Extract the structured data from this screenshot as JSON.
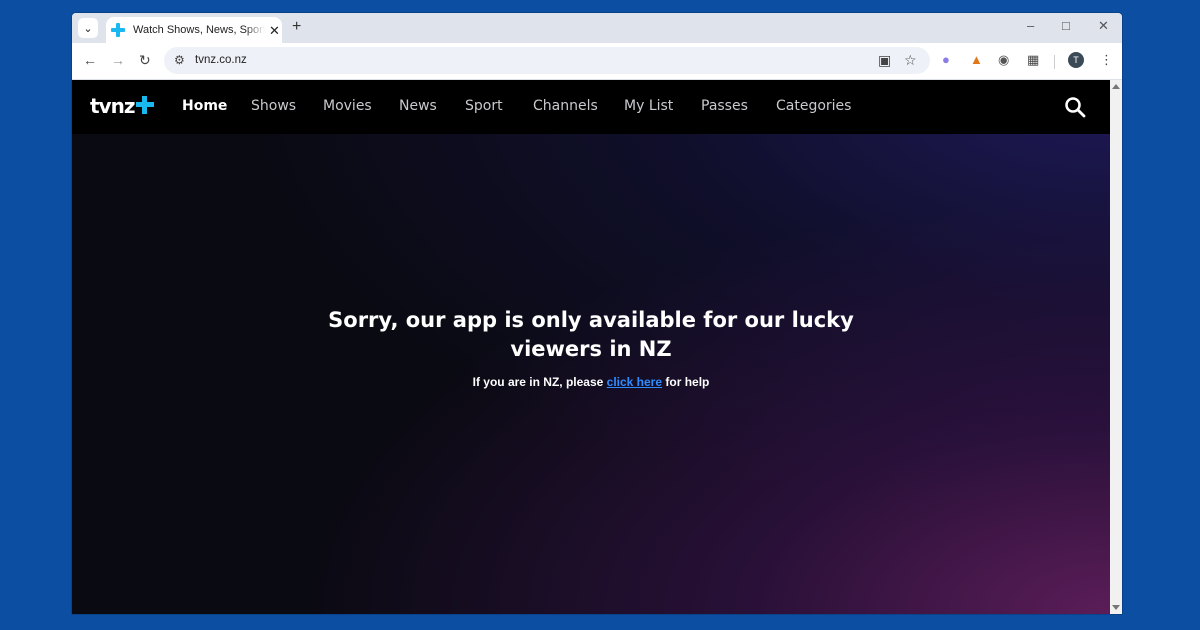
{
  "browser": {
    "tab_title": "Watch Shows, News, Sport, Movies",
    "url": "tvnz.co.nz",
    "avatar_initial": "T"
  },
  "site": {
    "logo_text": "tvnz",
    "nav": [
      {
        "label": "Home",
        "active": true
      },
      {
        "label": "Shows"
      },
      {
        "label": "Movies"
      },
      {
        "label": "News"
      },
      {
        "label": "Sport"
      },
      {
        "label": "Channels"
      },
      {
        "label": "My List"
      },
      {
        "label": "Passes"
      },
      {
        "label": "Categories"
      }
    ]
  },
  "message": {
    "title_line1": "Sorry, our app is only available for our lucky",
    "title_line2": "viewers in NZ",
    "sub_before": "If you are in NZ, please ",
    "sub_link": "click here",
    "sub_after": " for help"
  },
  "colors": {
    "accent": "#19b8f0",
    "link": "#2f8cff",
    "desktop": "#0b4ea2"
  }
}
